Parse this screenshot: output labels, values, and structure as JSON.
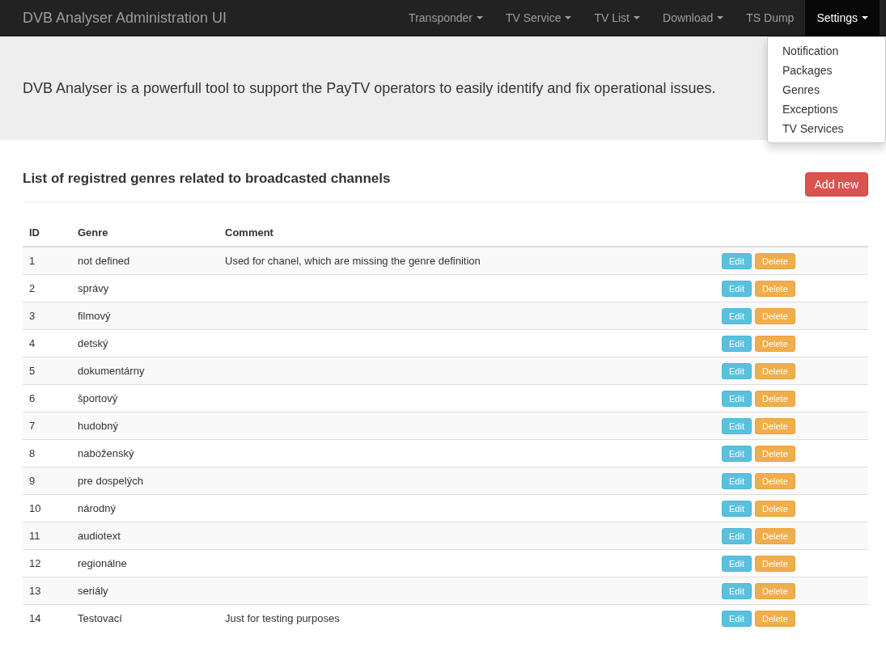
{
  "navbar": {
    "brand": "DVB Analyser Administration UI",
    "items": [
      {
        "label": "Transponder",
        "caret": true,
        "selected": false
      },
      {
        "label": "TV Service",
        "caret": true,
        "selected": false
      },
      {
        "label": "TV List",
        "caret": true,
        "selected": false
      },
      {
        "label": "Download",
        "caret": true,
        "selected": false
      },
      {
        "label": "TS Dump",
        "caret": false,
        "selected": false
      },
      {
        "label": "Settings",
        "caret": true,
        "selected": true
      }
    ],
    "dropdown": [
      "Notification",
      "Packages",
      "Genres",
      "Exceptions",
      "TV Services"
    ]
  },
  "jumbotron": {
    "text": "DVB Analyser is a powerfull tool to support the PayTV operators to easily identify and fix operational issues."
  },
  "section": {
    "title": "List of registred genres related to broadcasted channels",
    "add_button": "Add new"
  },
  "table": {
    "columns": [
      "ID",
      "Genre",
      "Comment"
    ],
    "rows": [
      {
        "id": "1",
        "genre": "not defined",
        "comment": "Used for chanel, which are missing the genre definition",
        "edit": "Edit",
        "delete": "Delete"
      },
      {
        "id": "2",
        "genre": "správy",
        "edit": "Edit",
        "delete": "Delete"
      },
      {
        "id": "3",
        "genre": "filmový",
        "edit": "Edit",
        "delete": "Delete"
      },
      {
        "id": "4",
        "genre": "detský",
        "edit": "Edit",
        "delete": "Delete"
      },
      {
        "id": "5",
        "genre": "dokumentárny",
        "edit": "Edit",
        "delete": "Delete"
      },
      {
        "id": "6",
        "genre": "športový",
        "edit": "Edit",
        "delete": "Delete"
      },
      {
        "id": "7",
        "genre": "hudobný",
        "edit": "Edit",
        "delete": "Delete"
      },
      {
        "id": "8",
        "genre": "naboženský",
        "edit": "Edit",
        "delete": "Delete"
      },
      {
        "id": "9",
        "genre": "pre dospelých",
        "edit": "Edit",
        "delete": "Delete"
      },
      {
        "id": "10",
        "genre": "národný",
        "edit": "Edit",
        "delete": "Delete"
      },
      {
        "id": "11",
        "genre": "audiotext",
        "edit": "Edit",
        "delete": "Delete"
      },
      {
        "id": "12",
        "genre": "regionálne",
        "edit": "Edit",
        "delete": "Delete"
      },
      {
        "id": "13",
        "genre": "seriály",
        "edit": "Edit",
        "delete": "Delete"
      },
      {
        "id": "14",
        "genre": "Testovací",
        "comment": "Just for testing purposes",
        "edit": "Edit",
        "delete": "Delete"
      }
    ]
  }
}
